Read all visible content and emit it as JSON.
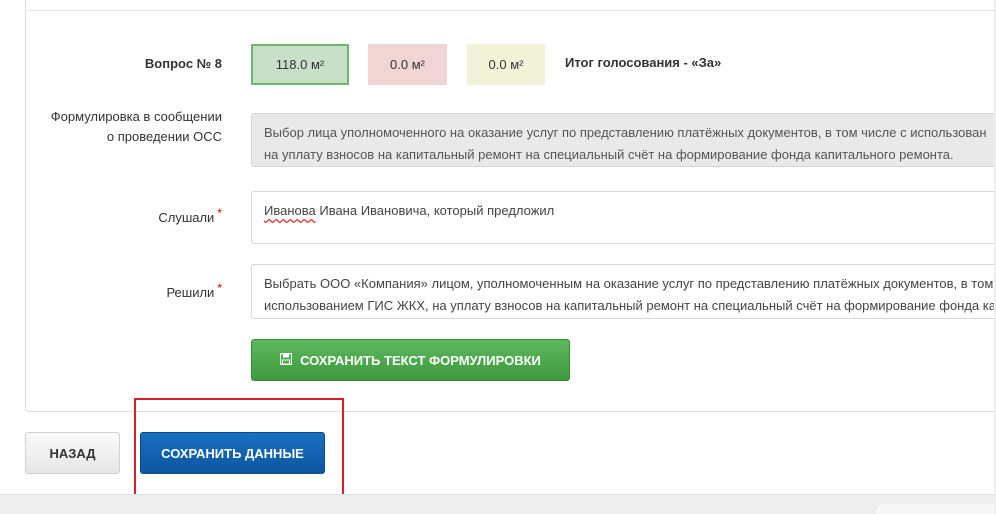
{
  "question": {
    "label": "Вопрос № 8",
    "votes": {
      "yes": "118.0 м²",
      "no": "0.0 м²",
      "abstain": "0.0 м²"
    },
    "result": "Итог голосования - «За»"
  },
  "form": {
    "wording_label": "Формулировка в сообщении о проведении ОСС",
    "wording_line1": "Выбор лица уполномоченного на оказание услуг по представлению платёжных документов, в том числе с использован",
    "wording_line2": "на уплату взносов на капитальный ремонт на специальный счёт на формирование фонда капитального ремонта.",
    "heard_label": "Слушали",
    "heard_value_underlined": "Иванова",
    "heard_value_rest": " Ивана Ивановича, который предложил",
    "decided_label": "Решили",
    "decided_line1": "Выбрать ООО «Компания» лицом, уполномоченным на оказание услуг по представлению платёжных документов, в том",
    "decided_line2": "использованием ГИС ЖКХ, на уплату взносов на капитальный ремонт на специальный счёт на формирование фонда ка",
    "required_mark": "*",
    "save_wording_button": "СОХРАНИТЬ ТЕКСТ ФОРМУЛИРОВКИ"
  },
  "actions": {
    "back_button": "НАЗАД",
    "save_button": "СОХРАНИТЬ ДАННЫЕ"
  },
  "colors": {
    "green_button": "#4cae4c",
    "blue_button": "#1565b3",
    "highlight": "#d62027",
    "vote_yes": "#c8dfc8",
    "vote_no": "#f1d4d4",
    "vote_abstain": "#f2f2d8"
  },
  "icons": {
    "save_wording": "floppy-disk-icon"
  }
}
